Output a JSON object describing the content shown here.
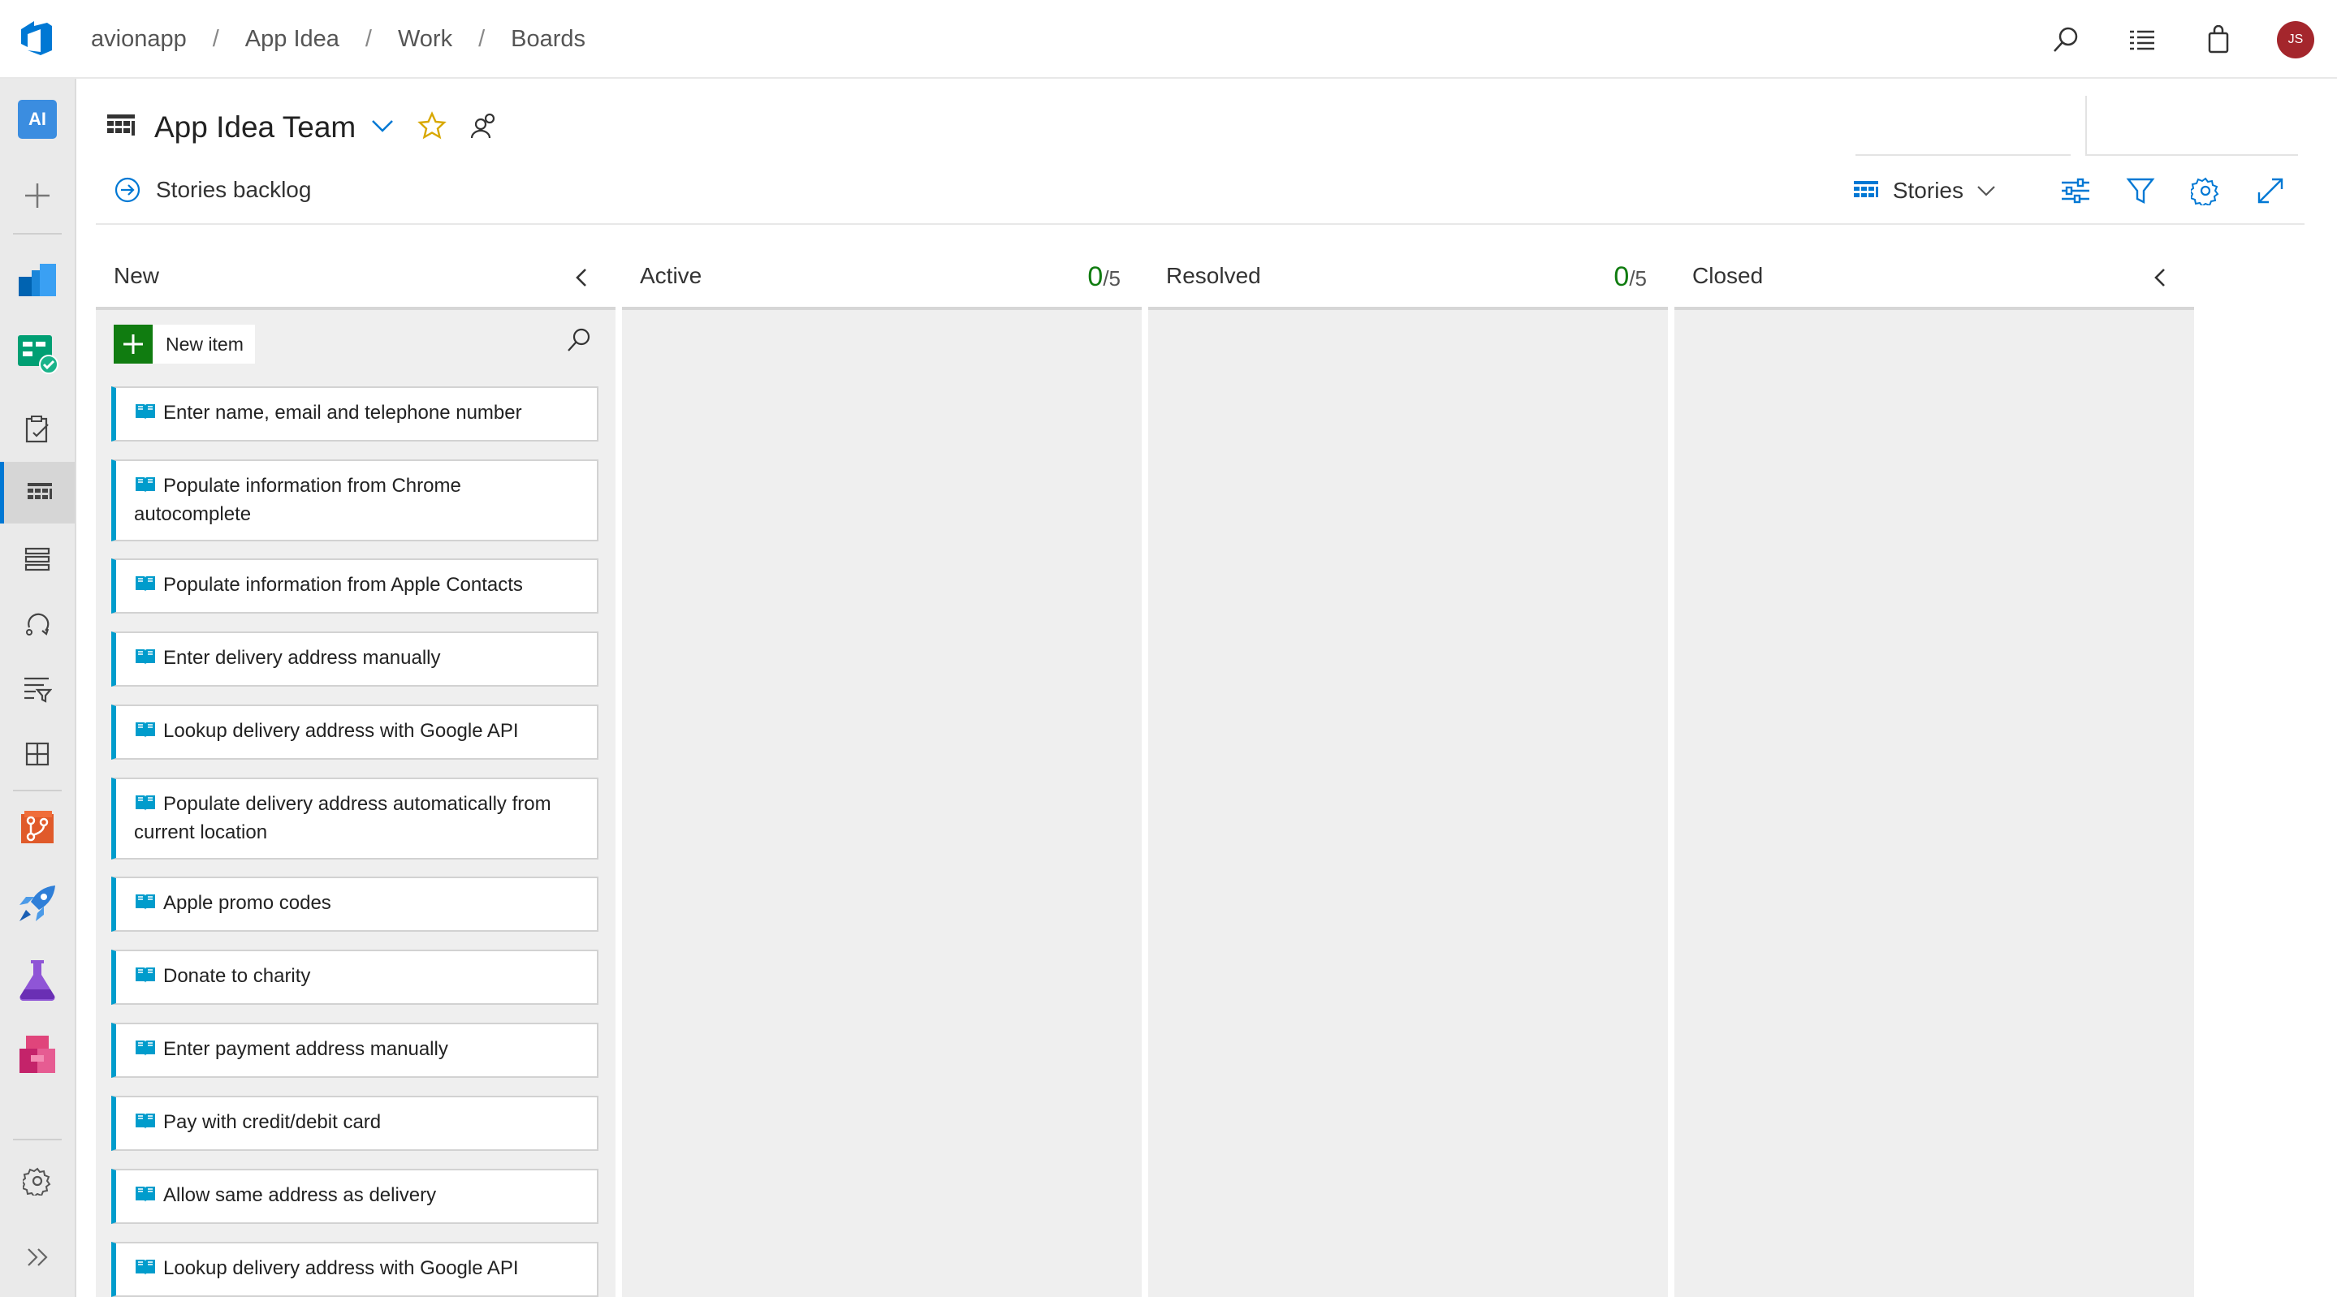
{
  "breadcrumb": [
    "avionapp",
    "App Idea",
    "Work",
    "Boards"
  ],
  "user": {
    "initials": "JS"
  },
  "project_badge": "AI",
  "team": {
    "title": "App Idea Team"
  },
  "backlog_link": "Stories backlog",
  "toolbar": {
    "level": "Stories"
  },
  "columns": [
    {
      "name": "New",
      "count": "",
      "limit": ""
    },
    {
      "name": "Active",
      "count": "0",
      "limit": "/5"
    },
    {
      "name": "Resolved",
      "count": "0",
      "limit": "/5"
    },
    {
      "name": "Closed",
      "count": "",
      "limit": ""
    }
  ],
  "new_item_label": "New item",
  "cards": [
    "Enter name, email and telephone number",
    "Populate information from Chrome autocomplete",
    "Populate information from Apple Contacts",
    "Enter delivery address manually",
    "Lookup delivery address with Google API",
    "Populate delivery address automatically from current location",
    "Apple promo codes",
    "Donate to charity",
    "Enter payment address manually",
    "Pay with credit/debit card",
    "Allow same address as delivery",
    "Lookup delivery address with Google API"
  ],
  "colors": {
    "accent": "#0078d4",
    "card_accent": "#009ccc",
    "green": "#107c10",
    "avatar": "#a4262c"
  }
}
